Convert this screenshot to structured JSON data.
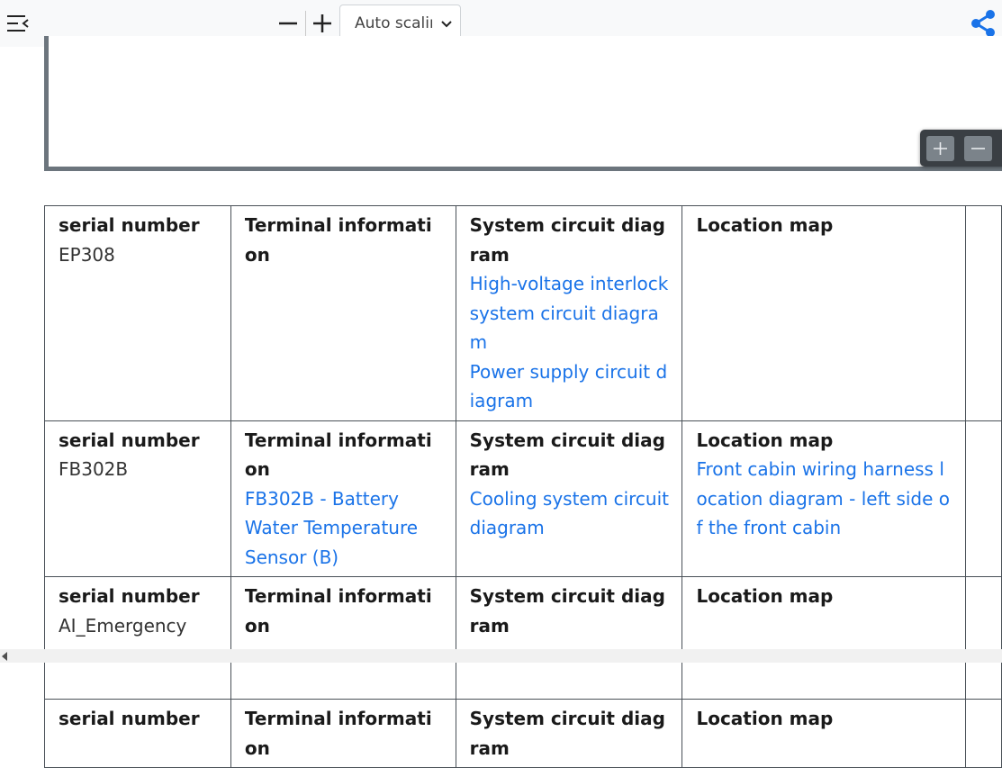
{
  "toolbar": {
    "sidebar_icon": "sidebar-toggle-icon",
    "zoom_out_icon": "minus-icon",
    "zoom_in_icon": "plus-icon",
    "scale_select": {
      "selected": "Auto scaling"
    },
    "share_icon": "share-icon",
    "accent_color": "#1a73e8"
  },
  "map_controls": {
    "zoom_in_icon": "plus-icon",
    "zoom_out_icon": "minus-icon"
  },
  "table": {
    "headers": {
      "serial": "serial number",
      "terminal": "Terminal information",
      "system": "System circuit diagram",
      "location": "Location map"
    },
    "rows": [
      {
        "serial": "EP308",
        "terminal_links": [],
        "system_links": [
          "High-voltage interlock system circuit diagram",
          "Power supply circuit diagram"
        ],
        "location_links": []
      },
      {
        "serial": "FB302B",
        "terminal_links": [
          "FB302B - Battery Water Temperature Sensor (B)"
        ],
        "system_links": [
          "Cooling system circuit diagram"
        ],
        "location_links": [
          "Front cabin wiring harness location diagram - left side of the front cabin"
        ]
      },
      {
        "serial": "AI_Emergency",
        "terminal_links": [],
        "system_links": [],
        "location_links": []
      },
      {
        "serial": "",
        "terminal_links": [],
        "system_links": [],
        "location_links": []
      }
    ]
  },
  "colors": {
    "link": "#1a73e8",
    "border": "#495057",
    "frame": "#6c757d"
  }
}
